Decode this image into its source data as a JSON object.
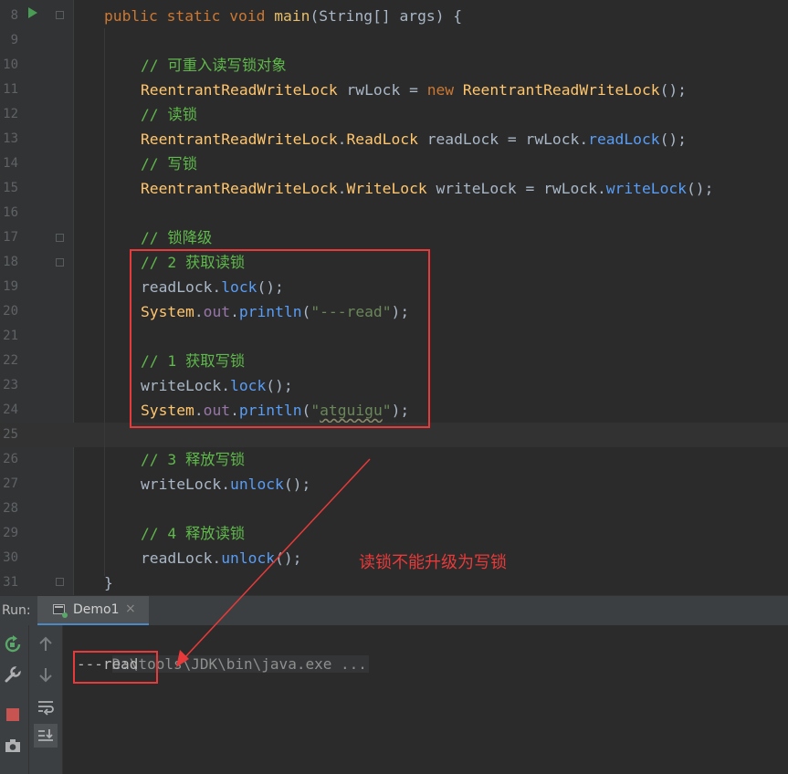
{
  "editor": {
    "lines": [
      {
        "n": "8",
        "html": "<span class='kw'>public static void </span><span class='fn'>main</span>(String[] args) {"
      },
      {
        "n": "9",
        "html": ""
      },
      {
        "n": "10",
        "html": "<span class='cm'>// 可重入读写锁对象</span>"
      },
      {
        "n": "11",
        "html": "<span class='ty'>ReentrantReadWriteLock</span> rwLock = <span class='kw'>new </span><span class='ty'>ReentrantReadWriteLock</span>();"
      },
      {
        "n": "12",
        "html": "<span class='cm'>// 读锁</span>"
      },
      {
        "n": "13",
        "html": "<span class='ty'>ReentrantReadWriteLock</span>.<span class='ty'>ReadLock</span> readLock = rwLock.<span class='mt'>readLock</span>();"
      },
      {
        "n": "14",
        "html": "<span class='cm'>// 写锁</span>"
      },
      {
        "n": "15",
        "html": "<span class='ty'>ReentrantReadWriteLock</span>.<span class='ty'>WriteLock</span> writeLock = rwLock.<span class='mt'>writeLock</span>();"
      },
      {
        "n": "16",
        "html": ""
      },
      {
        "n": "17",
        "html": "<span class='cm'>// 锁降级</span>"
      },
      {
        "n": "18",
        "html": "<span class='cm'>// 2 获取读锁</span>"
      },
      {
        "n": "19",
        "html": "readLock.<span class='mt'>lock</span>();"
      },
      {
        "n": "20",
        "html": "<span class='ty'>System</span>.<span class='sf'>out</span>.<span class='mt'>println</span>(<span class='st'>\"---read\"</span>);"
      },
      {
        "n": "21",
        "html": ""
      },
      {
        "n": "22",
        "html": "<span class='cm'>// 1 获取写锁</span>"
      },
      {
        "n": "23",
        "html": "writeLock.<span class='mt'>lock</span>();"
      },
      {
        "n": "24",
        "html": "<span class='ty'>System</span>.<span class='sf'>out</span>.<span class='mt'>println</span>(<span class='st'>\"<span class='squig'>atguigu</span>\"</span>);"
      },
      {
        "n": "25",
        "html": ""
      },
      {
        "n": "26",
        "html": "<span class='cm'>// 3 释放写锁</span>"
      },
      {
        "n": "27",
        "html": "writeLock.<span class='mt'>unlock</span>();"
      },
      {
        "n": "28",
        "html": ""
      },
      {
        "n": "29",
        "html": "<span class='cm'>// 4 释放读锁</span>"
      },
      {
        "n": "30",
        "html": "readLock.<span class='mt'>unlock</span>();"
      },
      {
        "n": "31",
        "html": "}"
      }
    ]
  },
  "annotation": {
    "text": "读锁不能升级为写锁",
    "color": "#e83a3a"
  },
  "run_panel": {
    "label": "Run:",
    "tab_label": "Demo1",
    "tab_close": "×",
    "console": {
      "command": "D:\\tools\\JDK\\bin\\java.exe ...",
      "output": "---read"
    }
  },
  "icons": {
    "rerun": "rerun-icon",
    "wrench": "wrench-icon",
    "stop": "stop-icon",
    "camera": "camera-icon",
    "up": "arrow-up-icon",
    "down": "arrow-down-icon",
    "soft_wrap": "soft-wrap-icon",
    "scroll_end": "scroll-to-end-icon"
  }
}
